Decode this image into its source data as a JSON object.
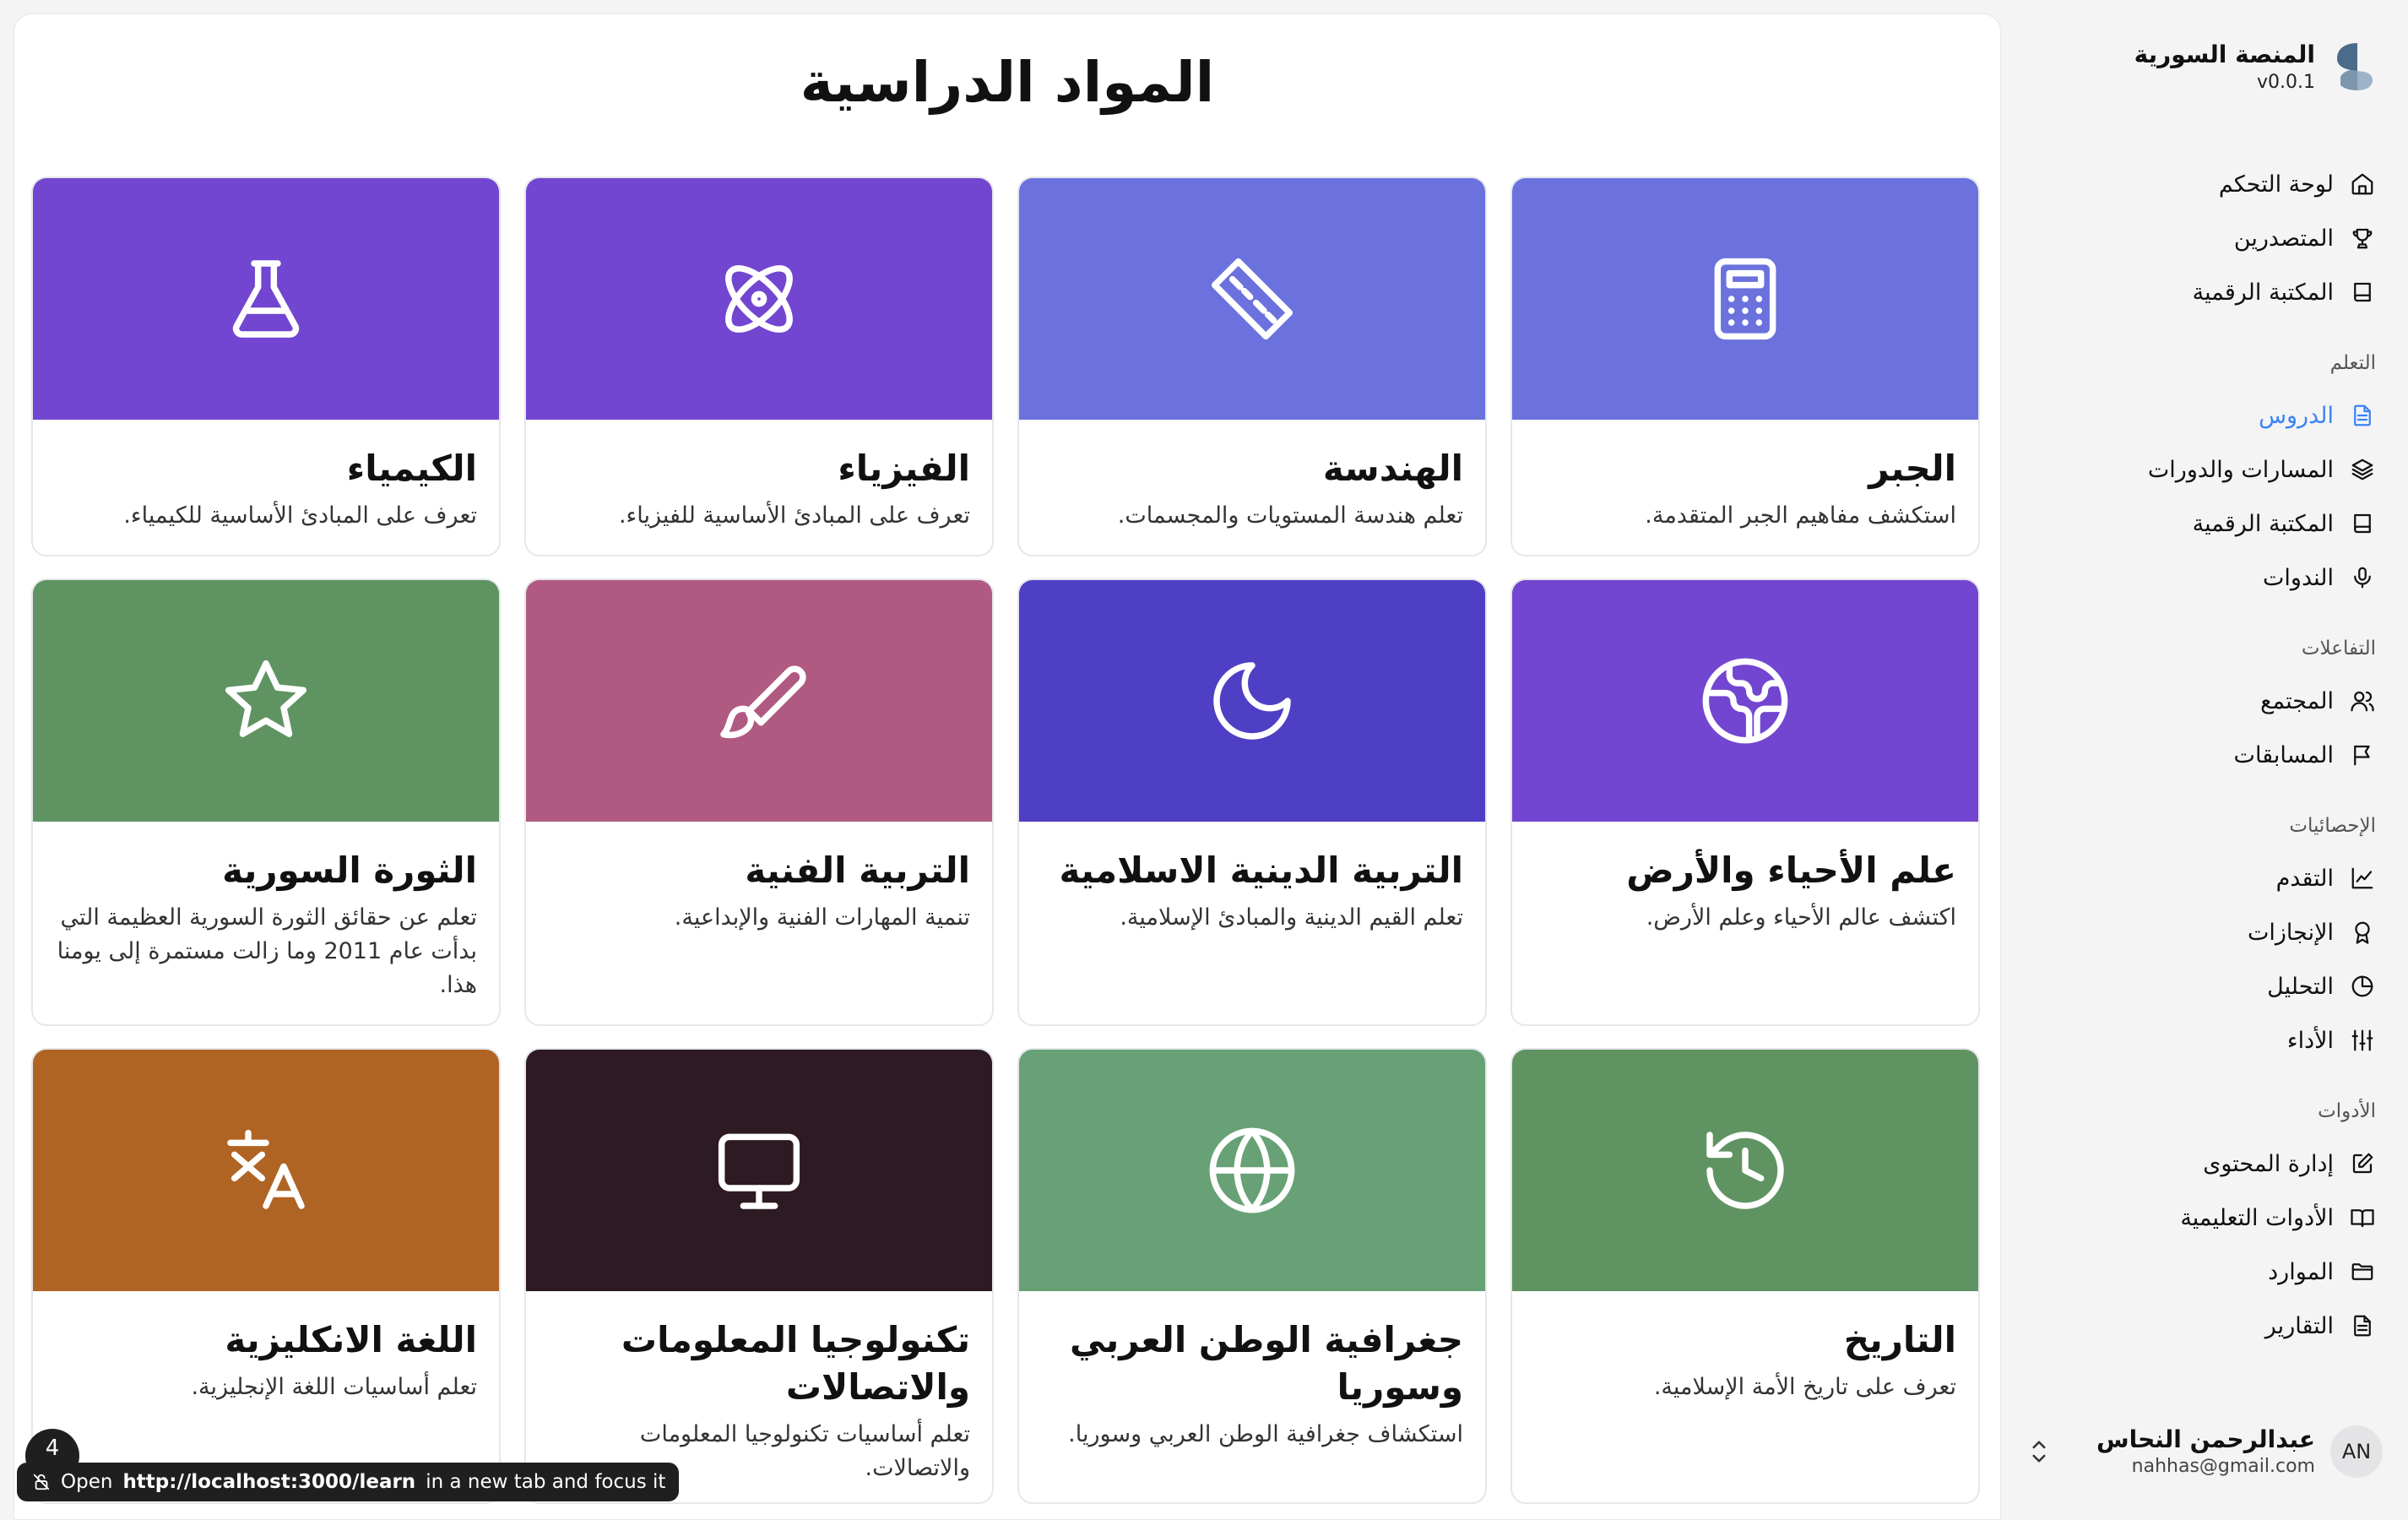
{
  "app": {
    "name": "المنصة السورية",
    "version": "v0.0.1"
  },
  "sidebar": {
    "top_items": [
      {
        "label": "لوحة التحكم",
        "icon": "home-icon"
      },
      {
        "label": "المتصدرين",
        "icon": "trophy-icon"
      },
      {
        "label": "المكتبة الرقمية",
        "icon": "book-icon"
      }
    ],
    "groups": [
      {
        "label": "التعلم",
        "items": [
          {
            "label": "الدروس",
            "icon": "file-text-icon",
            "active": true
          },
          {
            "label": "المسارات والدورات",
            "icon": "layers-icon"
          },
          {
            "label": "المكتبة الرقمية",
            "icon": "book-icon"
          },
          {
            "label": "الندوات",
            "icon": "mic-icon"
          }
        ]
      },
      {
        "label": "التفاعلات",
        "items": [
          {
            "label": "المجتمع",
            "icon": "users-icon"
          },
          {
            "label": "المسابقات",
            "icon": "flag-icon"
          }
        ]
      },
      {
        "label": "الإحصائيات",
        "items": [
          {
            "label": "التقدم",
            "icon": "line-chart-icon"
          },
          {
            "label": "الإنجازات",
            "icon": "award-icon"
          },
          {
            "label": "التحليل",
            "icon": "pie-chart-icon"
          },
          {
            "label": "الأداء",
            "icon": "sliders-icon"
          }
        ]
      },
      {
        "label": "الأدوات",
        "items": [
          {
            "label": "إدارة المحتوى",
            "icon": "edit-icon"
          },
          {
            "label": "الأدوات التعليمية",
            "icon": "book-open-icon"
          },
          {
            "label": "الموارد",
            "icon": "folder-icon"
          },
          {
            "label": "التقارير",
            "icon": "report-icon"
          }
        ]
      }
    ]
  },
  "user": {
    "initials": "AN",
    "name": "عبدالرحمن النحاس",
    "email": "nahhas@gmail.com"
  },
  "main": {
    "title": "المواد الدراسية",
    "subjects": [
      {
        "title": "الجبر",
        "desc": "استكشف مفاهيم الجبر المتقدمة.",
        "color": "#6b72dd",
        "icon": "calculator-icon"
      },
      {
        "title": "الهندسة",
        "desc": "تعلم هندسة المستويات والمجسمات.",
        "color": "#6b72dd",
        "icon": "ruler-icon"
      },
      {
        "title": "الفيزياء",
        "desc": "تعرف على المبادئ الأساسية للفيزياء.",
        "color": "#7246d0",
        "icon": "atom-icon"
      },
      {
        "title": "الكيمياء",
        "desc": "تعرف على المبادئ الأساسية للكيمياء.",
        "color": "#7246d0",
        "icon": "flask-icon"
      },
      {
        "title": "علم الأحياء والأرض",
        "desc": "اكتشف عالم الأحياء وعلم الأرض.",
        "color": "#7246d0",
        "icon": "earth-icon"
      },
      {
        "title": "التربية الدينية الاسلامية",
        "desc": "تعلم القيم الدينية والمبادئ الإسلامية.",
        "color": "#4f3fc4",
        "icon": "moon-icon"
      },
      {
        "title": "التربية الفنية",
        "desc": "تنمية المهارات الفنية والإبداعية.",
        "color": "#b05a82",
        "icon": "brush-icon"
      },
      {
        "title": "الثورة السورية",
        "desc": "تعلم عن حقائق الثورة السورية العظيمة التي بدأت عام 2011 وما زالت مستمرة إلى يومنا هذا.",
        "color": "#5f9462",
        "icon": "star-icon"
      },
      {
        "title": "التاريخ",
        "desc": "تعرف على تاريخ الأمة الإسلامية.",
        "color": "#5f9462",
        "icon": "history-icon"
      },
      {
        "title": "جغرافية الوطن العربي وسوريا",
        "desc": "استكشاف جغرافية الوطن العربي وسوريا.",
        "color": "#67a175",
        "icon": "globe-icon"
      },
      {
        "title": "تكنولوجيا المعلومات والاتصالات",
        "desc": "تعلم أساسيات تكنولوجيا المعلومات والاتصالات.",
        "color": "#2d1a23",
        "icon": "monitor-icon"
      },
      {
        "title": "اللغة الانكليزية",
        "desc": "تعلم أساسيات اللغة الإنجليزية.",
        "color": "#b06424",
        "icon": "translate-icon"
      }
    ]
  },
  "tooltip": {
    "prefix": "Open",
    "url": "http://localhost:3000/learn",
    "suffix": "in a new tab and focus it",
    "corner_badge": "4"
  }
}
